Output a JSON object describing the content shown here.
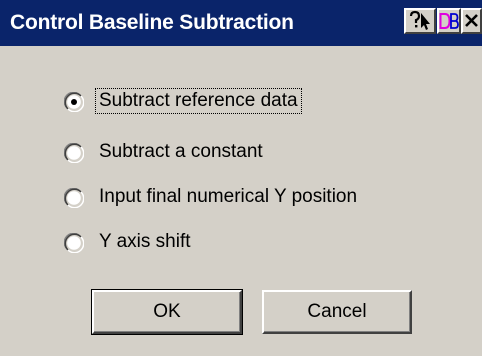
{
  "window": {
    "title": "Control Baseline Subtraction",
    "titlebar_color": "#0a246a",
    "face_color": "#d4d0c8",
    "title_buttons": [
      {
        "name": "help-arrow-icon"
      },
      {
        "name": "db-icon",
        "label": "DB"
      },
      {
        "name": "close-icon"
      }
    ]
  },
  "options": [
    {
      "label": "Subtract reference data",
      "selected": true
    },
    {
      "label": "Subtract a constant",
      "selected": false
    },
    {
      "label": "Input final numerical Y position",
      "selected": false
    },
    {
      "label": "Y axis shift",
      "selected": false
    }
  ],
  "buttons": {
    "ok_label": "OK",
    "cancel_label": "Cancel"
  }
}
